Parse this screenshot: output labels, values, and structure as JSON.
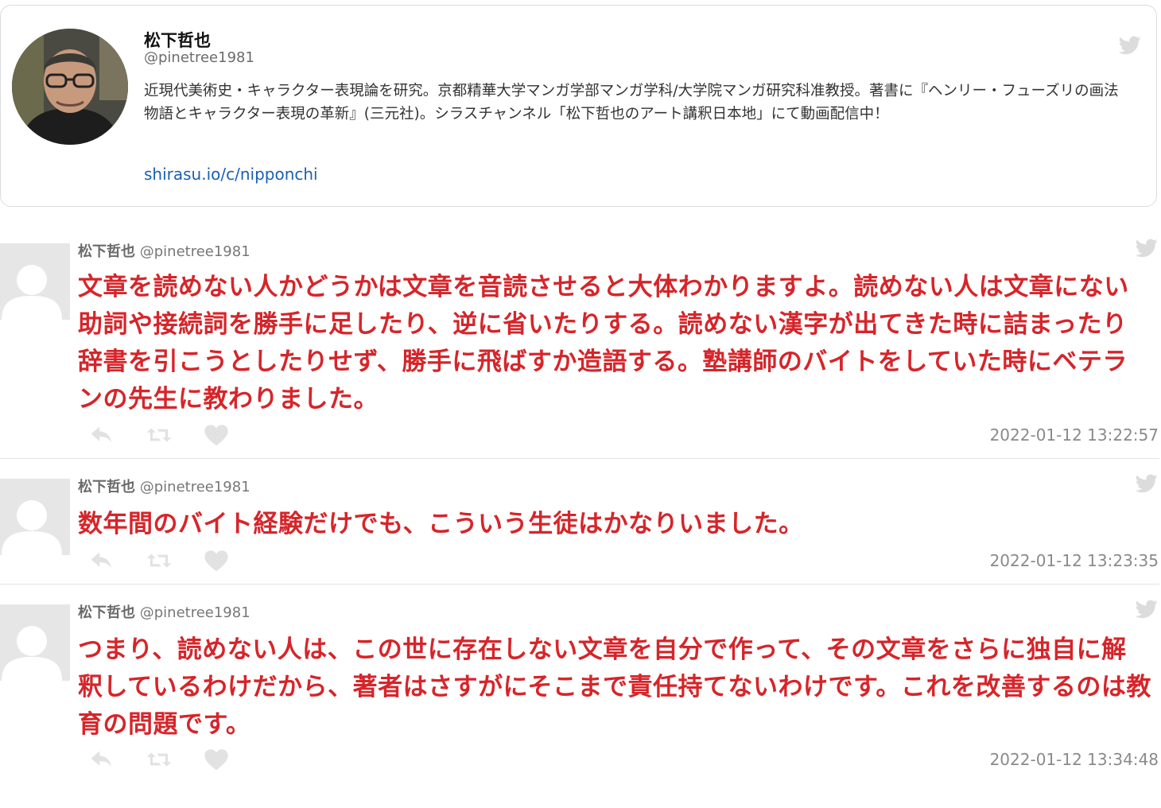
{
  "profile": {
    "name": "松下哲也",
    "handle": "@pinetree1981",
    "bio": "近現代美術史・キャラクター表現論を研究。京都精華大学マンガ学部マンガ学科/大学院マンガ研究科准教授。著書に『ヘンリー・フューズリの画法 物語とキャラクター表現の革新』(三元社)。シラスチャンネル「松下哲也のアート講釈日本地」にて動画配信中！",
    "link": "shirasu.io/c/nipponchi"
  },
  "tweets": [
    {
      "name": "松下哲也",
      "handle": "@pinetree1981",
      "text": "文章を読めない人かどうかは文章を音読させると大体わかりますよ。読めない人は文章にない助詞や接続詞を勝手に足したり、逆に省いたりする。読めない漢字が出てきた時に詰まったり辞書を引こうとしたりせず、勝手に飛ばすか造語する。塾講師のバイトをしていた時にベテランの先生に教わりました。",
      "timestamp": "2022-01-12 13:22:57"
    },
    {
      "name": "松下哲也",
      "handle": "@pinetree1981",
      "text": "数年間のバイト経験だけでも、こういう生徒はかなりいました。",
      "timestamp": "2022-01-12 13:23:35"
    },
    {
      "name": "松下哲也",
      "handle": "@pinetree1981",
      "text": "つまり、読めない人は、この世に存在しない文章を自分で作って、その文章をさらに独自に解釈しているわけだから、著者はさすがにそこまで責任持てないわけです。これを改善するのは教育の問題です。",
      "timestamp": "2022-01-12 13:34:48"
    }
  ],
  "icons": {
    "bird": "twitter-bird-icon",
    "reply": "reply-icon",
    "retweet": "retweet-icon",
    "like": "heart-icon"
  },
  "colors": {
    "tweet_text": "#d6252a",
    "link": "#1a5fb4",
    "icon_gray": "#e0e0e0"
  }
}
